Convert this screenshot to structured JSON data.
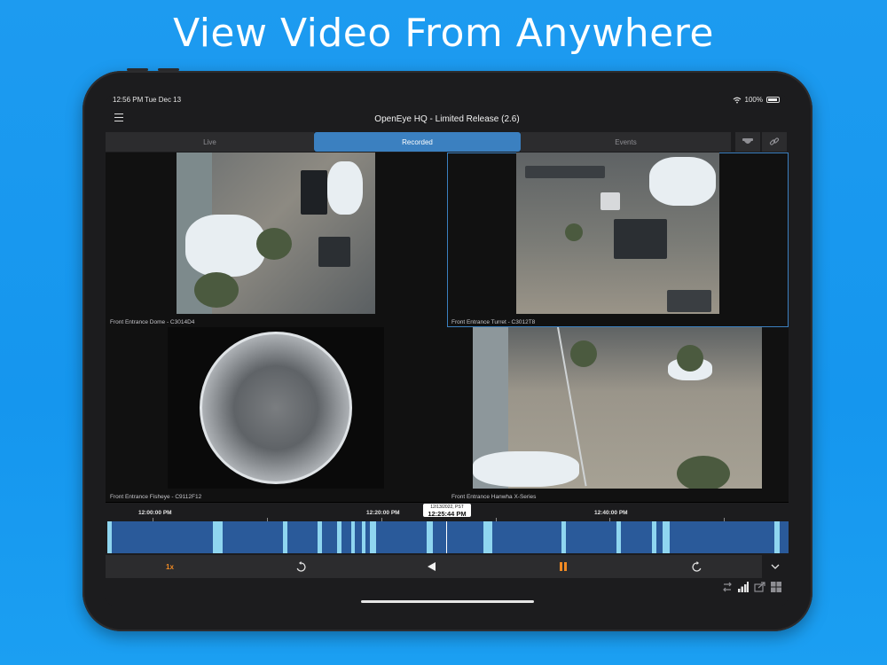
{
  "headline": "View Video From Anywhere",
  "status": {
    "time": "12:56 PM",
    "date": "Tue Dec 13",
    "battery": "100%"
  },
  "app": {
    "title": "OpenEye HQ - Limited Release (2.6)"
  },
  "tabs": [
    {
      "label": "Live",
      "active": false
    },
    {
      "label": "Recorded",
      "active": true
    },
    {
      "label": "Events",
      "active": false
    }
  ],
  "cameras": [
    {
      "label": "Front Entrance Dome - C3014D4",
      "selected": false
    },
    {
      "label": "Front Entrance Turret - C3012T8",
      "selected": true
    },
    {
      "label": "Front Entrance Fisheye - C9112F12",
      "selected": false
    },
    {
      "label": "Front Entrance Hanwha X-Series",
      "selected": false
    }
  ],
  "timeline": {
    "ticks": [
      "12:00:00 PM",
      "12:20:00 PM",
      "12:40:00 PM"
    ],
    "cursor_date": "12/13/2022, PST",
    "cursor_time": "12:25:44 PM"
  },
  "controls": {
    "speed": "1x"
  },
  "colors": {
    "accent": "#3b80c0",
    "speed": "#f08a24",
    "recorded": "#8fd6f0",
    "track": "#2a5a9a",
    "background": "#1d9bf0"
  },
  "icons": [
    "menu-icon",
    "wifi-icon",
    "battery-icon",
    "camera-dome-icon",
    "link-icon",
    "rewind-icon",
    "play-reverse-icon",
    "pause-icon",
    "forward-icon",
    "chevron-down-icon",
    "swap-icon",
    "signal-icon",
    "share-icon",
    "grid-icon"
  ]
}
